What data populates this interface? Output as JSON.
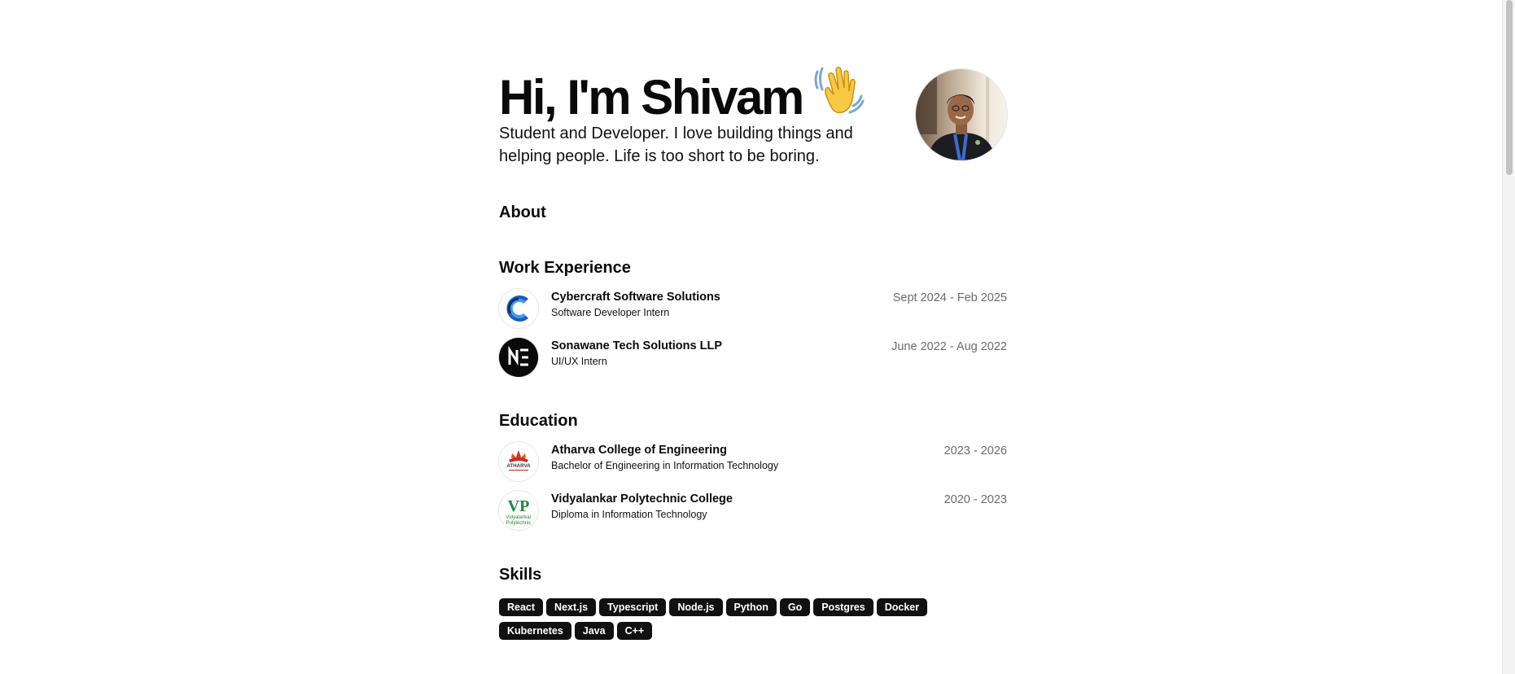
{
  "hero": {
    "greeting": "Hi, I'm Shivam",
    "wave_icon": "waving-hand-emoji",
    "subtitle": "Student and Developer. I love building things and helping people. Life is too short to be boring."
  },
  "sections": {
    "about": "About",
    "work": "Work Experience",
    "education": "Education",
    "skills": "Skills"
  },
  "work": [
    {
      "name": "Cybercraft Software Solutions",
      "role": "Software Developer Intern",
      "dates": "Sept 2024 - Feb 2025",
      "logo_icon": "cybercraft-logo-icon"
    },
    {
      "name": "Sonawane Tech Solutions LLP",
      "role": "UI/UX Intern",
      "dates": "June 2022 - Aug 2022",
      "logo_icon": "sonawane-logo-icon"
    }
  ],
  "education": [
    {
      "name": "Atharva College of Engineering",
      "role": "Bachelor of Engineering in Information Technology",
      "dates": "2023 - 2026",
      "logo_icon": "atharva-logo-icon",
      "logo_text": "ATHARVA"
    },
    {
      "name": "Vidyalankar Polytechnic College",
      "role": "Diploma in Information Technology",
      "dates": "2020 - 2023",
      "logo_icon": "vidyalankar-logo-icon",
      "logo_text": "VP",
      "logo_subtext_1": "Vidyalankar",
      "logo_subtext_2": "Polytechnic"
    }
  ],
  "skills": [
    "React",
    "Next.js",
    "Typescript",
    "Node.js",
    "Python",
    "Go",
    "Postgres",
    "Docker",
    "Kubernetes",
    "Java",
    "C++"
  ],
  "colors": {
    "text": "#0a0a0a",
    "muted": "#6b6b6b",
    "badge_bg": "#111111",
    "badge_text": "#ffffff",
    "cybercraft_blue": "#2f8ae8",
    "atharva_red": "#d13a1e",
    "vidyalankar_green": "#1d8a3c"
  }
}
